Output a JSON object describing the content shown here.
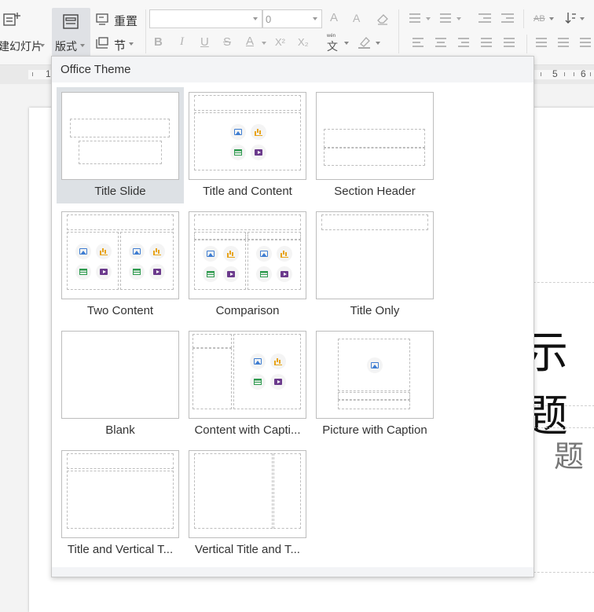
{
  "ribbon": {
    "new_slide_label": "建幻灯片",
    "layout_label": "版式",
    "reset_label": "重置",
    "section_label": "节",
    "font_name_value": "",
    "font_size_value": "0",
    "bold": "B",
    "italic": "I",
    "underline": "U",
    "strike": "S",
    "font_color": "A",
    "superscript": "X²",
    "subscript": "X₂",
    "phonetic": "wén",
    "phonetic_char": "文",
    "grow_font": "A",
    "shrink_font": "A",
    "text_box": "AB"
  },
  "ruler": {
    "numbers": [
      "1",
      "5",
      "6"
    ]
  },
  "slide": {
    "title_fragment": "示题",
    "subtitle_fragment": "题"
  },
  "layout_menu": {
    "header": "Office Theme",
    "layouts": [
      {
        "label": "Title Slide",
        "selected": true
      },
      {
        "label": "Title and Content",
        "selected": false
      },
      {
        "label": "Section Header",
        "selected": false
      },
      {
        "label": "Two Content",
        "selected": false
      },
      {
        "label": "Comparison",
        "selected": false
      },
      {
        "label": "Title Only",
        "selected": false
      },
      {
        "label": "Blank",
        "selected": false
      },
      {
        "label": "Content with Capti...",
        "selected": false
      },
      {
        "label": "Picture with Caption",
        "selected": false
      },
      {
        "label": "Title and Vertical T...",
        "selected": false
      },
      {
        "label": "Vertical Title and T...",
        "selected": false
      }
    ]
  },
  "colors": {
    "selection_bg": "#dde1e5",
    "picture_icon": "#3d7cd1",
    "chart_icon": "#e8a318",
    "table_icon": "#2e9a4e",
    "video_icon": "#6b3a8c"
  }
}
